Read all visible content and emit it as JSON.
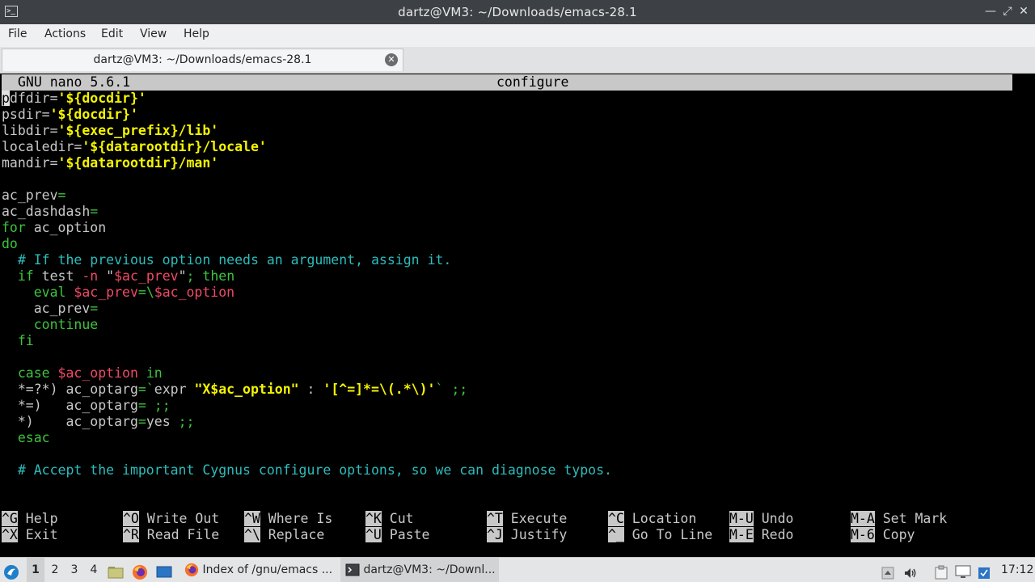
{
  "window": {
    "title": "dartz@VM3: ~/Downloads/emacs-28.1",
    "minimize_glyph": "—",
    "maximize_glyph": "⤢",
    "close_glyph": "✕",
    "app_icon_glyph": ">_"
  },
  "menubar": {
    "items": [
      "File",
      "Actions",
      "Edit",
      "View",
      "Help"
    ]
  },
  "tab": {
    "label": "dartz@VM3: ~/Downloads/emacs-28.1",
    "close_glyph": "✕"
  },
  "nano": {
    "version": "GNU nano 5.6.1",
    "filename": "configure",
    "cursor_char": "p"
  },
  "code_lines": [
    [
      {
        "t": "dfdir=",
        "c": "w"
      },
      {
        "t": "'${docdir}'",
        "c": "y"
      }
    ],
    [
      {
        "t": "psdir=",
        "c": "w"
      },
      {
        "t": "'${docdir}'",
        "c": "y"
      }
    ],
    [
      {
        "t": "libdir=",
        "c": "w"
      },
      {
        "t": "'${exec_prefix}/lib'",
        "c": "y"
      }
    ],
    [
      {
        "t": "localedir=",
        "c": "w"
      },
      {
        "t": "'${datarootdir}/locale'",
        "c": "y"
      }
    ],
    [
      {
        "t": "mandir=",
        "c": "w"
      },
      {
        "t": "'${datarootdir}/man'",
        "c": "y"
      }
    ],
    [],
    [
      {
        "t": "ac_prev",
        "c": "w"
      },
      {
        "t": "=",
        "c": "g"
      }
    ],
    [
      {
        "t": "ac_dashdash",
        "c": "w"
      },
      {
        "t": "=",
        "c": "g"
      }
    ],
    [
      {
        "t": "for",
        "c": "g"
      },
      {
        "t": " ac_option",
        "c": "w"
      }
    ],
    [
      {
        "t": "do",
        "c": "g"
      }
    ],
    [
      {
        "t": "  # If the previous option needs an argument, assign it.",
        "c": "c"
      }
    ],
    [
      {
        "t": "  ",
        "c": "w"
      },
      {
        "t": "if",
        "c": "g"
      },
      {
        "t": " test ",
        "c": "w"
      },
      {
        "t": "-n",
        "c": "r"
      },
      {
        "t": " \"",
        "c": "w"
      },
      {
        "t": "$ac_prev",
        "c": "r"
      },
      {
        "t": "\"",
        "c": "w"
      },
      {
        "t": "; then",
        "c": "g"
      }
    ],
    [
      {
        "t": "    eval ",
        "c": "g"
      },
      {
        "t": "$ac_prev",
        "c": "r"
      },
      {
        "t": "=\\",
        "c": "g"
      },
      {
        "t": "$ac_option",
        "c": "r"
      }
    ],
    [
      {
        "t": "    ac_prev",
        "c": "w"
      },
      {
        "t": "=",
        "c": "g"
      }
    ],
    [
      {
        "t": "    continue",
        "c": "g"
      }
    ],
    [
      {
        "t": "  fi",
        "c": "g"
      }
    ],
    [],
    [
      {
        "t": "  case ",
        "c": "g"
      },
      {
        "t": "$ac_option",
        "c": "r"
      },
      {
        "t": " in",
        "c": "g"
      }
    ],
    [
      {
        "t": "  *=?*) ac_optarg",
        "c": "w"
      },
      {
        "t": "=`",
        "c": "g"
      },
      {
        "t": "expr ",
        "c": "w"
      },
      {
        "t": "\"X$ac_option\"",
        "c": "y"
      },
      {
        "t": " : ",
        "c": "w"
      },
      {
        "t": "'[^=]*=\\(.*\\)'",
        "c": "y"
      },
      {
        "t": "` ;;",
        "c": "g"
      }
    ],
    [
      {
        "t": "  *=)   ac_optarg",
        "c": "w"
      },
      {
        "t": "= ;;",
        "c": "g"
      }
    ],
    [
      {
        "t": "  *)    ac_optarg",
        "c": "w"
      },
      {
        "t": "=",
        "c": "g"
      },
      {
        "t": "yes ",
        "c": "w"
      },
      {
        "t": ";;",
        "c": "g"
      }
    ],
    [
      {
        "t": "  esac",
        "c": "g"
      }
    ],
    [],
    [
      {
        "t": "  # Accept the important Cygnus configure options, so we can diagnose typos.",
        "c": "c"
      }
    ]
  ],
  "shortcuts": [
    [
      {
        "key": "^G",
        "label": "Help"
      },
      {
        "key": "^X",
        "label": "Exit"
      }
    ],
    [
      {
        "key": "^O",
        "label": "Write Out"
      },
      {
        "key": "^R",
        "label": "Read File"
      }
    ],
    [
      {
        "key": "^W",
        "label": "Where Is"
      },
      {
        "key": "^\\",
        "label": "Replace"
      }
    ],
    [
      {
        "key": "^K",
        "label": "Cut"
      },
      {
        "key": "^U",
        "label": "Paste"
      }
    ],
    [
      {
        "key": "^T",
        "label": "Execute"
      },
      {
        "key": "^J",
        "label": "Justify"
      }
    ],
    [
      {
        "key": "^C",
        "label": "Location"
      },
      {
        "key": "^_",
        "label": "Go To Line"
      }
    ],
    [
      {
        "key": "M-U",
        "label": "Undo"
      },
      {
        "key": "M-E",
        "label": "Redo"
      }
    ],
    [
      {
        "key": "M-A",
        "label": "Set Mark"
      },
      {
        "key": "M-6",
        "label": "Copy"
      }
    ]
  ],
  "taskbar": {
    "desktops": [
      "1",
      "2",
      "3",
      "4"
    ],
    "active_desktop": "1",
    "tasks": [
      {
        "label": "Index of /gnu/emacs ...",
        "icon": "firefox-icon"
      },
      {
        "label": "dartz@VM3: ~/Downl...",
        "icon": "terminal-icon"
      }
    ],
    "clock": "17:12"
  },
  "colors": {
    "string": "#f4f400",
    "variable": "#f04a66",
    "keyword": "#3ec33e",
    "comment": "#2dbcbc",
    "plain": "#c8c8c8"
  }
}
